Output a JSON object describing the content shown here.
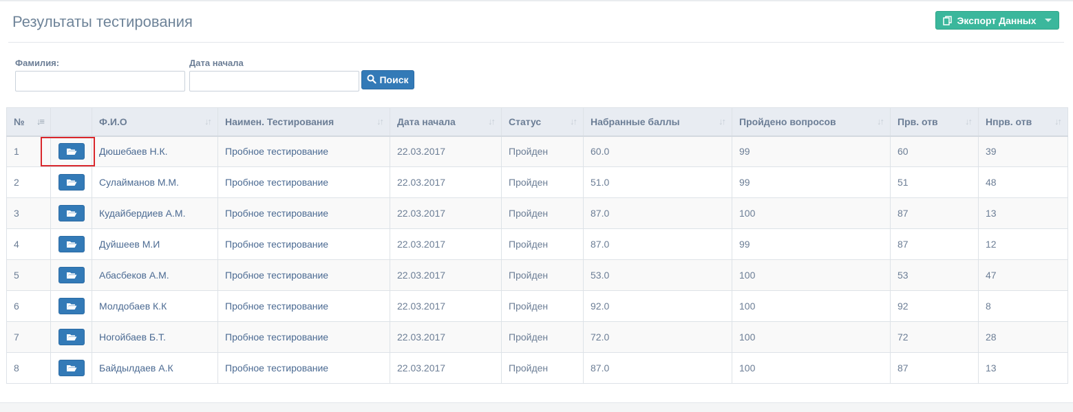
{
  "page": {
    "title": "Результаты тестирования",
    "export_label": "Экспорт Данных"
  },
  "filters": {
    "surname_label": "Фамилия:",
    "surname_value": "",
    "start_date_label": "Дата начала",
    "start_date_value": "",
    "search_label": "Поиск"
  },
  "table": {
    "columns": [
      "№",
      "",
      "Ф.И.О",
      "Наимен. Тестирования",
      "Дата начала",
      "Статус",
      "Набранные баллы",
      "Пройдено вопросов",
      "Прв. отв",
      "Нпрв. отв"
    ],
    "rows": [
      {
        "num": "1",
        "name": "Дюшебаев  Н.К.",
        "test": "Пробное тестирование",
        "date": "22.03.2017",
        "status": "Пройден",
        "score": "60.0",
        "answered": "99",
        "correct": "60",
        "wrong": "39"
      },
      {
        "num": "2",
        "name": "Сулайманов  М.М.",
        "test": "Пробное тестирование",
        "date": "22.03.2017",
        "status": "Пройден",
        "score": "51.0",
        "answered": "99",
        "correct": "51",
        "wrong": "48"
      },
      {
        "num": "3",
        "name": "Кудайбердиев  А.М.",
        "test": "Пробное тестирование",
        "date": "22.03.2017",
        "status": "Пройден",
        "score": "87.0",
        "answered": "100",
        "correct": "87",
        "wrong": "13"
      },
      {
        "num": "4",
        "name": "Дуйшеев  М.И",
        "test": "Пробное тестирование",
        "date": "22.03.2017",
        "status": "Пройден",
        "score": "87.0",
        "answered": "99",
        "correct": "87",
        "wrong": "12"
      },
      {
        "num": "5",
        "name": "Абасбеков  А.М.",
        "test": "Пробное тестирование",
        "date": "22.03.2017",
        "status": "Пройден",
        "score": "53.0",
        "answered": "100",
        "correct": "53",
        "wrong": "47"
      },
      {
        "num": "6",
        "name": "Молдобаев  К.К",
        "test": "Пробное тестирование",
        "date": "22.03.2017",
        "status": "Пройден",
        "score": "92.0",
        "answered": "100",
        "correct": "92",
        "wrong": "8"
      },
      {
        "num": "7",
        "name": "Ногойбаев   Б.Т.",
        "test": "Пробное тестирование",
        "date": "22.03.2017",
        "status": "Пройден",
        "score": "72.0",
        "answered": "100",
        "correct": "72",
        "wrong": "28"
      },
      {
        "num": "8",
        "name": "Байдылдаев  А.К",
        "test": "Пробное тестирование",
        "date": "22.03.2017",
        "status": "Пройден",
        "score": "87.0",
        "answered": "100",
        "correct": "87",
        "wrong": "13"
      }
    ]
  },
  "icons": {
    "export": "copy-icon",
    "export_menu": "caret-down-icon",
    "search": "search-icon",
    "row_action": "folder-open-icon",
    "sort": "sort-icon"
  },
  "colors": {
    "export_button": "#3bb79c",
    "primary_button": "#337ab7",
    "highlight": "#d9262b"
  }
}
